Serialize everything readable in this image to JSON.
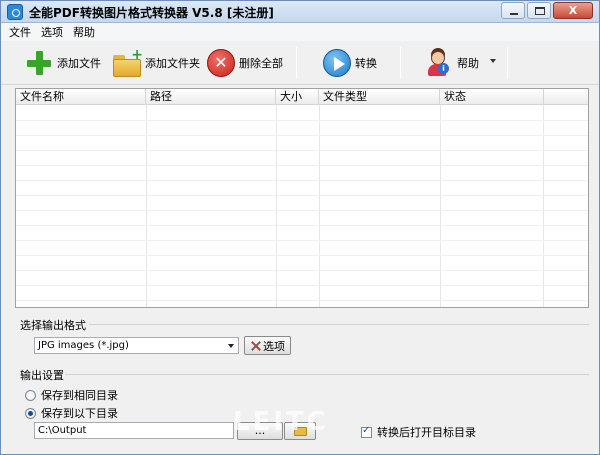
{
  "window": {
    "title": "全能PDF转换图片格式转换器 V5.8 [未注册]",
    "buttons": {
      "minimize": "minimize",
      "maximize": "maximize",
      "close": "X"
    }
  },
  "menu": {
    "items": [
      "文件",
      "选项",
      "帮助"
    ]
  },
  "toolbar": {
    "add_file": "添加文件",
    "add_folder": "添加文件夹",
    "delete_all": "删除全部",
    "convert": "转换",
    "help": "帮助"
  },
  "file_list": {
    "columns": [
      "文件名称",
      "路径",
      "大小",
      "文件类型",
      "状态"
    ],
    "rows": []
  },
  "output_format": {
    "group_title": "选择输出格式",
    "selected": "JPG images (*.jpg)",
    "options_button": "选项"
  },
  "output_settings": {
    "group_title": "输出设置",
    "radio_same_dir": "保存到相同目录",
    "radio_custom_dir": "保存到以下目录",
    "selected": "custom",
    "path": "C:\\Output",
    "browse_button": "...",
    "open_after_label": "转换后打开目标目录",
    "open_after_checked": true
  },
  "watermark": "LEITC"
}
